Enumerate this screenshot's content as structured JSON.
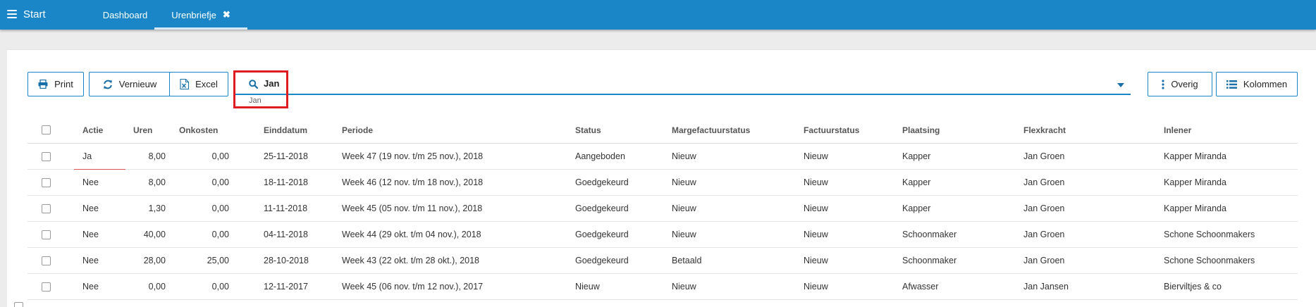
{
  "topbar": {
    "start_label": "Start",
    "tabs": [
      {
        "label": "Dashboard",
        "closable": false
      },
      {
        "label": "Urenbriefje",
        "closable": true,
        "close_glyph": "✖"
      }
    ],
    "color": "#1a86c8"
  },
  "toolbar": {
    "print_label": "Print",
    "vernieuw_label": "Vernieuw",
    "excel_label": "Excel",
    "overig_label": "Overig",
    "kolommen_label": "Kolommen",
    "icons": {
      "print": "printer-icon",
      "vernieuw": "refresh-icon",
      "excel": "excel-file-icon",
      "overig": "vertical-ellipsis-icon",
      "kolommen": "list-columns-icon"
    }
  },
  "search": {
    "value": "Jan",
    "chip": "Jan",
    "icon": "search-icon"
  },
  "table": {
    "headers": [
      "Actie",
      "Uren",
      "Onkosten",
      "Einddatum",
      "Periode",
      "Status",
      "Margefactuurstatus",
      "Factuurstatus",
      "Plaatsing",
      "Flexkracht",
      "Inlener"
    ],
    "rows": [
      {
        "actie": "Ja",
        "uren": "8,00",
        "onkosten": "0,00",
        "einddatum": "25-11-2018",
        "periode": "Week 47 (19 nov. t/m 25 nov.), 2018",
        "status": "Aangeboden",
        "marge": "Nieuw",
        "factuur": "Nieuw",
        "plaatsing": "Kapper",
        "flexkracht": "Jan Groen",
        "inlener": "Kapper Miranda"
      },
      {
        "actie": "Nee",
        "uren": "8,00",
        "onkosten": "0,00",
        "einddatum": "18-11-2018",
        "periode": "Week 46 (12 nov. t/m 18 nov.), 2018",
        "status": "Goedgekeurd",
        "marge": "Nieuw",
        "factuur": "Nieuw",
        "plaatsing": "Kapper",
        "flexkracht": "Jan Groen",
        "inlener": "Kapper Miranda"
      },
      {
        "actie": "Nee",
        "uren": "1,30",
        "onkosten": "0,00",
        "einddatum": "11-11-2018",
        "periode": "Week 45 (05 nov. t/m 11 nov.), 2018",
        "status": "Goedgekeurd",
        "marge": "Nieuw",
        "factuur": "Nieuw",
        "plaatsing": "Kapper",
        "flexkracht": "Jan Groen",
        "inlener": "Kapper Miranda"
      },
      {
        "actie": "Nee",
        "uren": "40,00",
        "onkosten": "0,00",
        "einddatum": "04-11-2018",
        "periode": "Week 44 (29 okt. t/m 04 nov.), 2018",
        "status": "Goedgekeurd",
        "marge": "Nieuw",
        "factuur": "Nieuw",
        "plaatsing": "Schoonmaker",
        "flexkracht": "Jan Groen",
        "inlener": "Schone Schoonmakers"
      },
      {
        "actie": "Nee",
        "uren": "28,00",
        "onkosten": "25,00",
        "einddatum": "28-10-2018",
        "periode": "Week 43 (22 okt. t/m 28 okt.), 2018",
        "status": "Goedgekeurd",
        "marge": "Betaald",
        "factuur": "Nieuw",
        "plaatsing": "Schoonmaker",
        "flexkracht": "Jan Groen",
        "inlener": "Schone Schoonmakers"
      },
      {
        "actie": "Nee",
        "uren": "0,00",
        "onkosten": "0,00",
        "einddatum": "12-11-2017",
        "periode": "Week 45 (06 nov. t/m 12 nov.), 2017",
        "status": "Nieuw",
        "marge": "Nieuw",
        "factuur": "Nieuw",
        "plaatsing": "Afwasser",
        "flexkracht": "Jan Jansen",
        "inlener": "Bierviltjes & co"
      }
    ]
  },
  "colors": {
    "accent": "#1a86c8",
    "highlight": "#e01b22"
  }
}
